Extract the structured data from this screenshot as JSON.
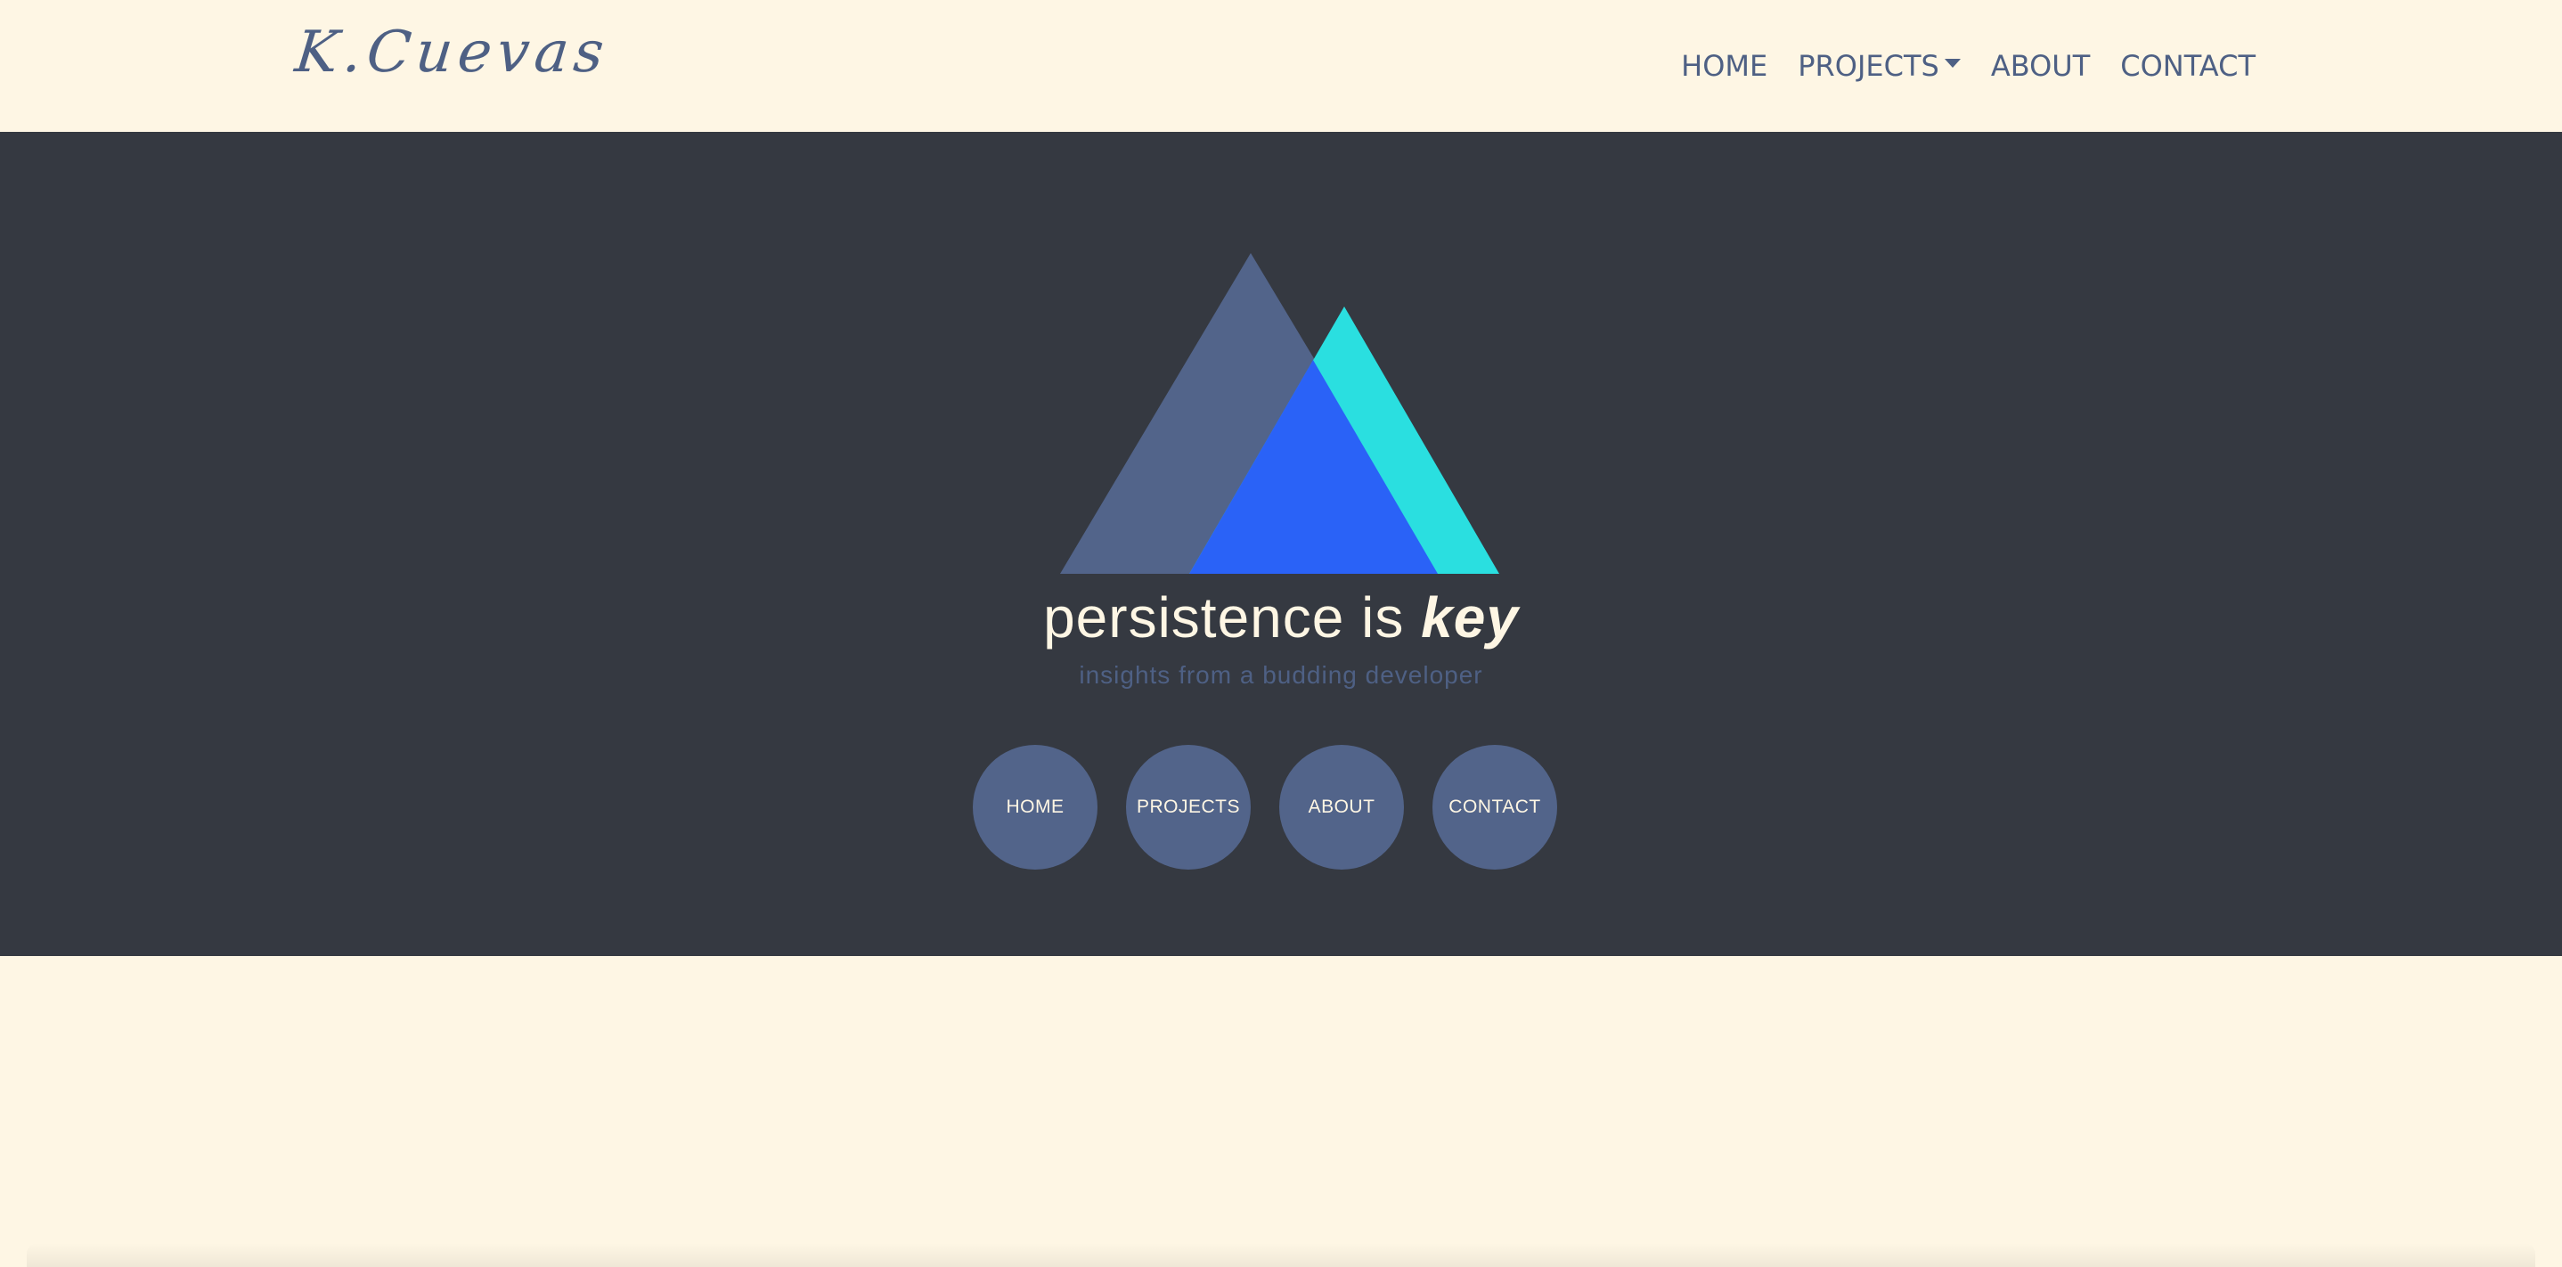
{
  "brand": {
    "name": "K.Cuevas"
  },
  "nav": {
    "items": [
      {
        "label": "HOME"
      },
      {
        "label": "PROJECTS",
        "has_dropdown": true
      },
      {
        "label": "ABOUT"
      },
      {
        "label": "CONTACT"
      }
    ]
  },
  "hero": {
    "tagline_plain": "persistence is ",
    "tagline_emphasis": "key",
    "subtitle": "insights from a budding developer",
    "circle_buttons": [
      {
        "label": "HOME"
      },
      {
        "label": "PROJECTS"
      },
      {
        "label": "ABOUT"
      },
      {
        "label": "CONTACT"
      }
    ]
  },
  "colors": {
    "page_bg": "#fef6e4",
    "hero_bg": "#353941",
    "slate": "#4e6084",
    "cyan": "#2adfe0",
    "blue": "#2a62f7"
  }
}
